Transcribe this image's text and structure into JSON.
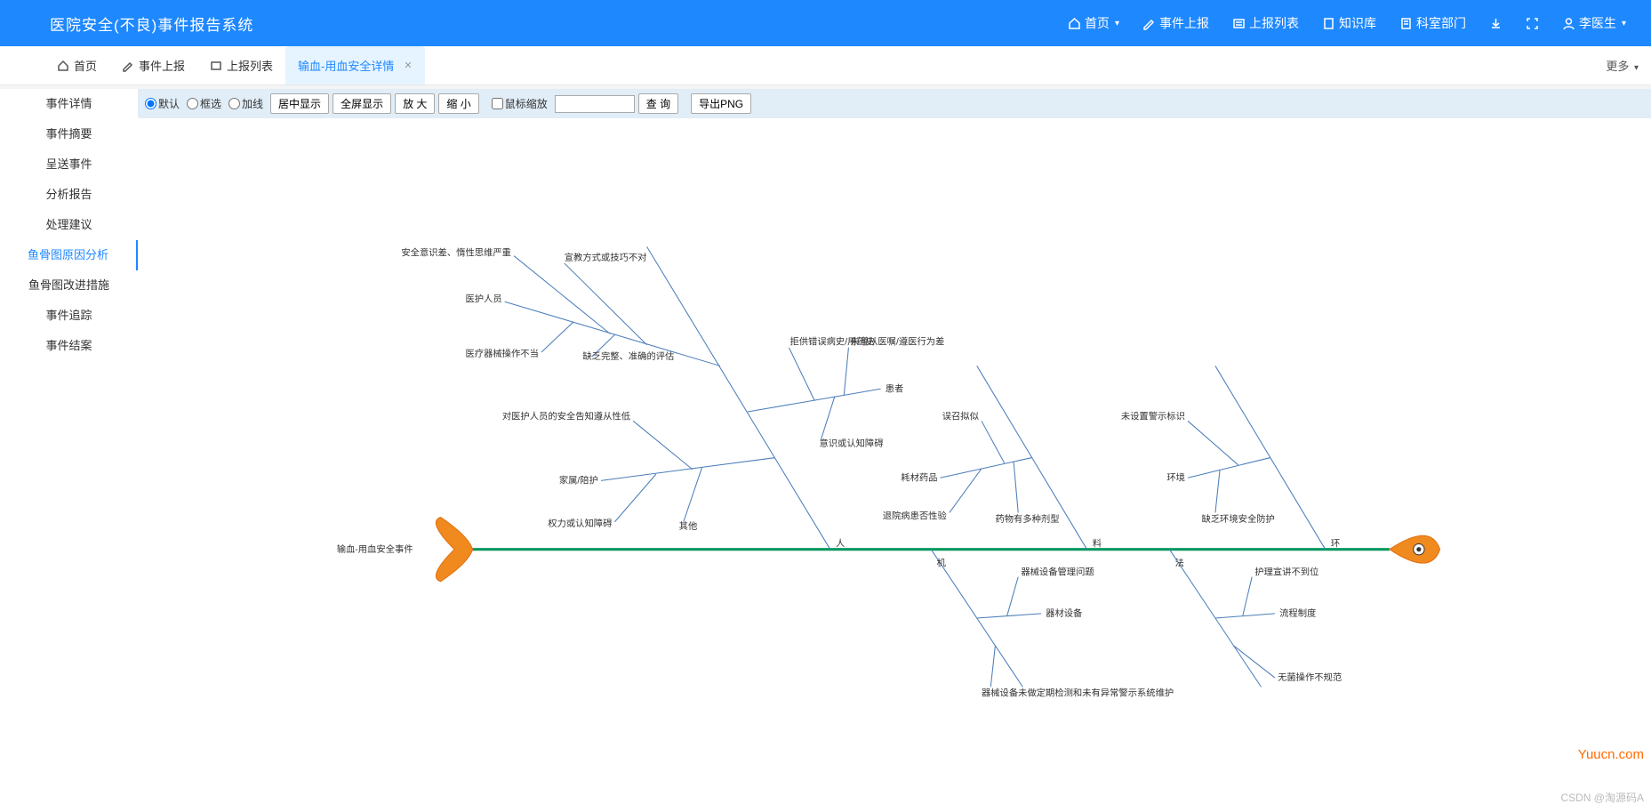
{
  "app": {
    "title": "医院安全(不良)事件报告系统"
  },
  "topnav": {
    "home": "首页",
    "report": "事件上报",
    "list": "上报列表",
    "kb": "知识库",
    "dept": "科室部门",
    "user": "李医生"
  },
  "tabs": {
    "home": "首页",
    "report": "事件上报",
    "list": "上报列表",
    "detail": "输血-用血安全详情",
    "more": "更多"
  },
  "sidenav": {
    "items": [
      "事件详情",
      "事件摘要",
      "呈送事件",
      "分析报告",
      "处理建议",
      "鱼骨图原因分析",
      "鱼骨图改进措施",
      "事件追踪",
      "事件结案"
    ],
    "active_index": 5
  },
  "toolbar": {
    "mode_default": "默认",
    "mode_box": "框选",
    "mode_line": "加线",
    "center": "居中显示",
    "fullscreen": "全屏显示",
    "zoom_in": "放 大",
    "zoom_out": "缩 小",
    "wheel_zoom": "鼠标缩放",
    "search_placeholder": "",
    "query": "查 询",
    "export_png": "导出PNG"
  },
  "fishbone": {
    "head_problem": "输血-用血安全事件",
    "branches": [
      {
        "name": "人",
        "children": [
          {
            "name": "医护人员",
            "children": [
              "安全意识差、惰性思维严重",
              "宣教方式或技巧不对",
              "医疗器械操作不当",
              "缺乏完整、准确的评估"
            ]
          },
          {
            "name": "家属/陪护",
            "children": [
              "对医护人员的安全告知遵从性低",
              "权力或认知障碍",
              "其他"
            ]
          },
          {
            "name": "患者",
            "children": [
              "拒供错误病史/用药史",
              "未遵从医嘱/遵医行为差",
              "意识或认知障碍"
            ]
          }
        ]
      },
      {
        "name": "机",
        "children": [
          {
            "name": "器材设备",
            "children": [
              "器械设备管理问题",
              "器械设备未做定期检测和未有异常警示系统维护"
            ]
          }
        ]
      },
      {
        "name": "料",
        "children": [
          {
            "name": "耗材药品",
            "children": [
              "误召拟似",
              "退院病患否性验",
              "药物有多种剂型"
            ]
          }
        ]
      },
      {
        "name": "法",
        "children": [
          {
            "name": "流程制度",
            "children": [
              "护理宣讲不到位",
              "无菌操作不规范"
            ]
          }
        ]
      },
      {
        "name": "环",
        "children": [
          {
            "name": "环境",
            "children": [
              "未设置警示标识",
              "缺乏环境安全防护"
            ]
          }
        ]
      }
    ]
  },
  "watermark": {
    "right": "Yuucn.com",
    "bottom": "CSDN @淘源码A"
  }
}
